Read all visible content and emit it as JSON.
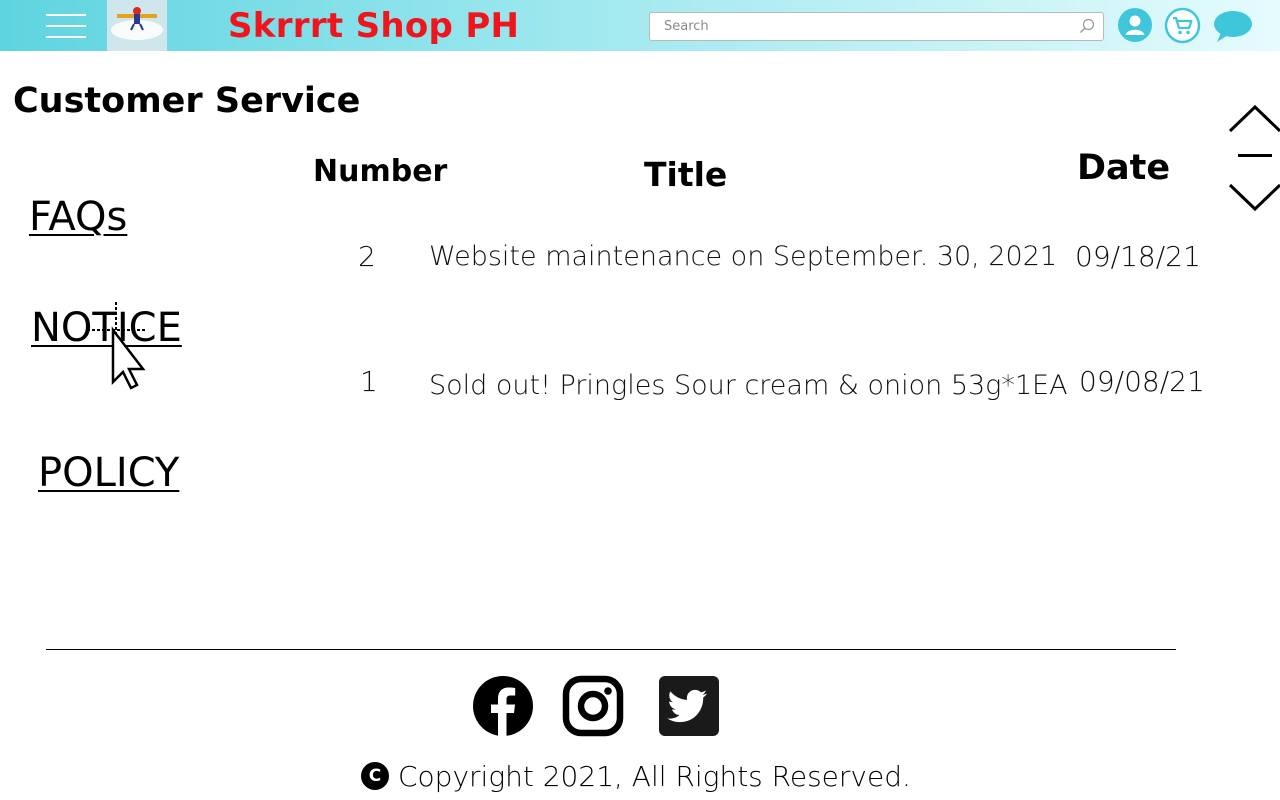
{
  "header": {
    "shop_name": "Skrrrt Shop PH",
    "search_placeholder": "Search",
    "colors": {
      "brand_red": "#f0141c",
      "header_teal": "#5ed4e0",
      "icon_blue": "#3fc6db"
    },
    "icons": [
      "menu-icon",
      "logo",
      "search-icon",
      "user-icon",
      "cart-icon",
      "chat-icon"
    ]
  },
  "page": {
    "title": "Customer Service"
  },
  "sidebar": {
    "links": [
      {
        "label": "FAQs"
      },
      {
        "label": "NOTICE"
      },
      {
        "label": "POLICY"
      }
    ]
  },
  "table": {
    "columns": [
      "Number",
      "Title",
      "Date"
    ],
    "rows": [
      {
        "number": "2",
        "title": "Website maintenance on September. 30, 2021",
        "date": "09/18/21"
      },
      {
        "number": "1",
        "title": "Sold out! Pringles Sour cream & onion 53g*1EA",
        "date": "09/08/21"
      }
    ]
  },
  "footer": {
    "social_icons": [
      "facebook-icon",
      "instagram-icon",
      "twitter-icon"
    ],
    "copyright": "Copyright 2021, All Rights Reserved."
  }
}
